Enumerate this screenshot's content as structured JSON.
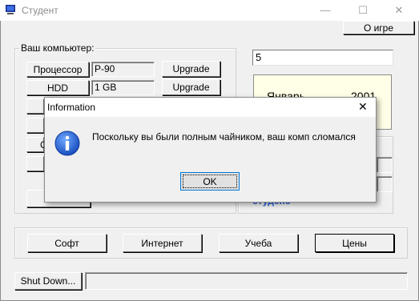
{
  "window": {
    "title": "Студент",
    "about_button": "О игре",
    "minimize": "—",
    "maximize": "☐",
    "close": "✕"
  },
  "computer": {
    "group_label": "Ваш компьютер:",
    "rows": [
      {
        "label": "Процессор",
        "value": "P-90",
        "upgrade": "Upgrade"
      },
      {
        "label": "HDD",
        "value": "1 GB",
        "upgrade": "Upgrade"
      }
    ],
    "partial_letter": "C"
  },
  "right": {
    "input_value": "5",
    "month": "Январь",
    "year": "2001",
    "partial_text": "студенс"
  },
  "nav": {
    "buttons": [
      "Софт",
      "Интернет",
      "Учеба",
      "Цены"
    ]
  },
  "bottom": {
    "shutdown": "Shut Down..."
  },
  "dialog": {
    "title": "Information",
    "message": "Поскольку вы были полным чайником, ваш комп сломался",
    "ok": "OK",
    "close": "✕"
  }
}
